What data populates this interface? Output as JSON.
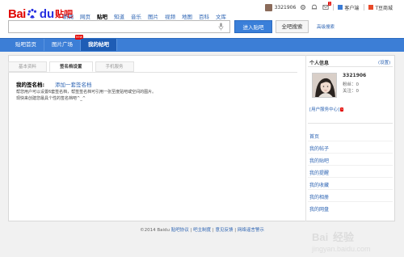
{
  "header": {
    "logo_bai": "Bai",
    "logo_du": "du",
    "logo_tieba": "贴吧",
    "nav": [
      "新闻",
      "网页",
      "贴吧",
      "知道",
      "音乐",
      "图片",
      "视频",
      "地图",
      "百科",
      "文库"
    ],
    "nav_active_index": 2,
    "username": "3321906",
    "message_badge": "1",
    "client_link": "客户端",
    "tmall_link": "T豆商城"
  },
  "search": {
    "value": "",
    "enter_button": "进入贴吧",
    "search_button": "全吧搜索",
    "advanced_link": "高级搜索"
  },
  "blue_tabs": {
    "items": [
      "贴吧首页",
      "图片广场",
      "我的帖吧"
    ],
    "active_index": 2,
    "new_tag": "new"
  },
  "settings_tabs": {
    "items": [
      "基本资料",
      "签名档设置",
      "手机服务"
    ],
    "active_index": 1
  },
  "signature": {
    "title": "我的签名档:",
    "add_link": "添加一套签名档",
    "desc1": "帮您用户可以设置6套签名档，帮签签名档可引用一张至度贴吧或空间的图片。",
    "desc2": "现快来创建您最具个性的签名档吧^_^"
  },
  "sidebar": {
    "title": "个人信息",
    "settings_link": "(设置)",
    "username": "3321906",
    "fans_label": "粉丝：0",
    "follow_label": "关注：0",
    "center_link": "[用户服务中心]",
    "center_tag": "v",
    "links": [
      "首页",
      "我的帖子",
      "我的贴吧",
      "我的提醒",
      "我的收藏",
      "我的相册",
      "我的网盘"
    ]
  },
  "footer": {
    "copyright": "©2014 Baidu",
    "links": [
      "贴吧协议",
      "吧主制度",
      "意见反馈",
      "网络谣言警示"
    ]
  },
  "colors": {
    "brand_red": "#e10602",
    "brand_blue": "#2932e1",
    "bar_blue": "#3c7ed6",
    "link_blue": "#2d64b3"
  }
}
